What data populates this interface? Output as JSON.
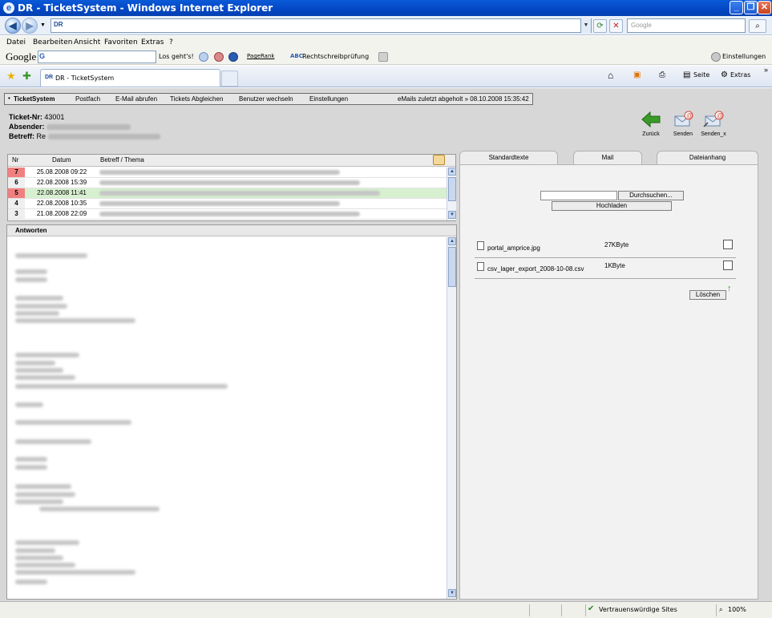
{
  "window": {
    "title": "DR - TicketSystem - Windows Internet Explorer"
  },
  "address": {
    "value": "DR",
    "search_placeholder": "Google"
  },
  "menu": [
    "Datei",
    "Bearbeiten",
    "Ansicht",
    "Favoriten",
    "Extras",
    "?"
  ],
  "google_toolbar": {
    "logo": "Google",
    "search_badge": "G",
    "go_label": "Los geht's!",
    "pagerank_label": "PageRank",
    "spellcheck_label": "Rechtschreibprüfung",
    "settings_label": "Einstellungen"
  },
  "tabs": [
    {
      "label": "DR - TicketSystem"
    }
  ],
  "commandbar": {
    "page_label": "Seite",
    "extras_label": "Extras"
  },
  "app_nav": {
    "brand": "TicketSystem",
    "items": [
      "Postfach",
      "E-Mail abrufen",
      "Tickets Abgleichen",
      "Benutzer wechseln",
      "Einstellungen"
    ],
    "status": "eMails zuletzt abgeholt » 08.10.2008 15:35:42"
  },
  "ticket": {
    "number_label": "Ticket-Nr:",
    "number": "43001",
    "sender_label": "Absender:",
    "subject_label": "Betreff:",
    "subject_prefix": "Re"
  },
  "actions": {
    "back": "Zurück",
    "send": "Senden",
    "send_x": "Senden_x"
  },
  "table": {
    "columns": [
      "Nr",
      "Datum",
      "Betreff / Thema"
    ],
    "rows": [
      {
        "nr": "7",
        "date": "25.08.2008 09:22",
        "flag": "red",
        "highlight": false
      },
      {
        "nr": "6",
        "date": "22.08.2008 15:39",
        "flag": "",
        "highlight": false
      },
      {
        "nr": "5",
        "date": "22.08.2008 11:41",
        "flag": "red",
        "highlight": true
      },
      {
        "nr": "4",
        "date": "22.08.2008 10:35",
        "flag": "",
        "highlight": false
      },
      {
        "nr": "3",
        "date": "21.08.2008 22:09",
        "flag": "",
        "highlight": false
      }
    ]
  },
  "answers": {
    "title": "Antworten"
  },
  "right_tabs": [
    "Standardtexte",
    "Mail",
    "Dateianhang"
  ],
  "attachments": {
    "browse_label": "Durchsuchen...",
    "upload_label": "Hochladen",
    "delete_label": "Löschen",
    "files": [
      {
        "name": "portal_amprice.jpg",
        "size": "27KByte"
      },
      {
        "name": "csv_lager_export_2008-10-08.csv",
        "size": "1KByte"
      }
    ]
  },
  "status": {
    "zone": "Vertrauenswürdige Sites",
    "zoom": "100%"
  },
  "colors": {
    "title_bar": "#0447c4",
    "flag_red": "#f08080",
    "row_highlight": "#d7f0d0",
    "back_arrow": "#3a9a2a"
  }
}
